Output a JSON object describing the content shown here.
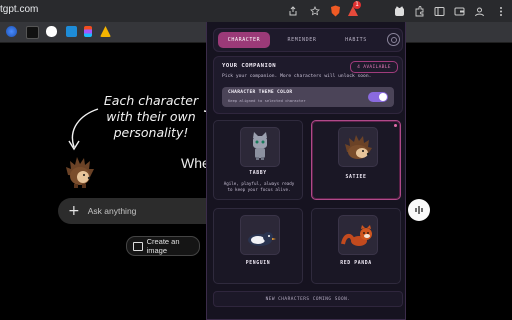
{
  "browser": {
    "url": "tgpt.com",
    "extension_badge": "1"
  },
  "page": {
    "annotation_text": "Each character with their own personality!",
    "partial_heading": "Whe",
    "ask_placeholder": "Ask anything",
    "ask_plus": "+",
    "create_image_label": "Create an image"
  },
  "popup": {
    "tabs": [
      "CHARACTER",
      "REMINDER",
      "HABITS"
    ],
    "active_tab": 0,
    "companion": {
      "title": "YOUR COMPANION",
      "available_badge": "4 AVAILABLE",
      "description": "Pick your companion. More characters will unlock soon.",
      "theme_title": "CHARACTER THEME COLOR",
      "theme_subtitle": "Keep aligned to selected character",
      "theme_on": true
    },
    "characters": [
      {
        "name": "TABBY",
        "description": "Agile, playful, always ready to keep your focus alive.",
        "selected": false
      },
      {
        "name": "SATIEE",
        "description": "",
        "selected": true
      },
      {
        "name": "PENGUIN",
        "description": "",
        "selected": false
      },
      {
        "name": "RED PANDA",
        "description": "",
        "selected": false
      }
    ],
    "coming_soon": "NEW CHARACTERS COMING SOON.",
    "colors": {
      "accent": "#9b3a78",
      "toggle": "#8a6adf",
      "bg": "#161320"
    }
  }
}
